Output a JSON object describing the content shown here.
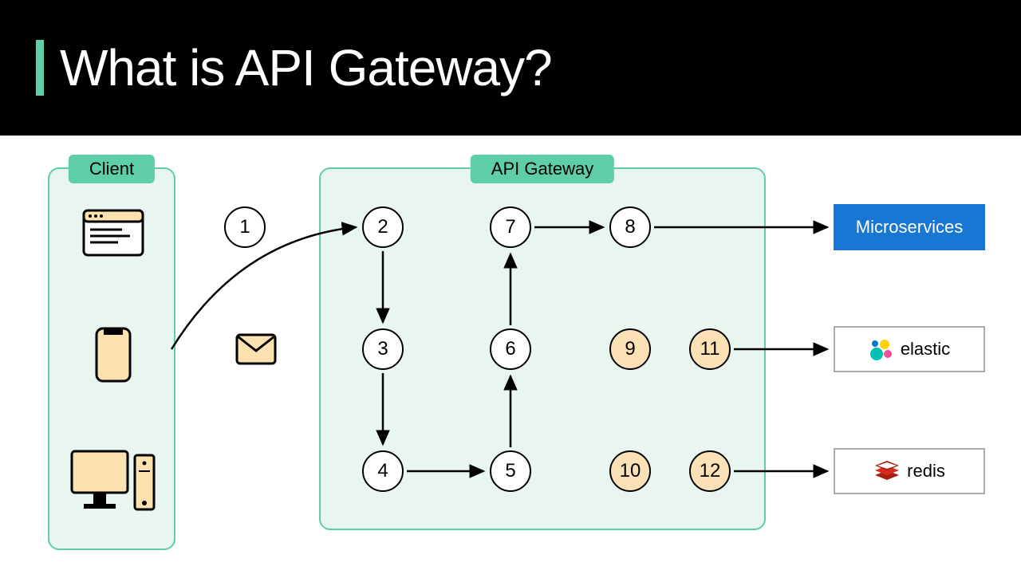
{
  "title": "What is API Gateway?",
  "panels": {
    "client": "Client",
    "gateway": "API Gateway"
  },
  "nodes": {
    "n1": "1",
    "n2": "2",
    "n3": "3",
    "n4": "4",
    "n5": "5",
    "n6": "6",
    "n7": "7",
    "n8": "8",
    "n9": "9",
    "n10": "10",
    "n11": "11",
    "n12": "12"
  },
  "services": {
    "microservices": "Microservices",
    "elastic": "elastic",
    "redis": "redis"
  },
  "clients": [
    "browser",
    "mobile",
    "desktop"
  ],
  "request_icon": "envelope",
  "arrows": [
    {
      "from": "client",
      "to": "n2",
      "curved": true
    },
    {
      "from": "n2",
      "to": "n3"
    },
    {
      "from": "n3",
      "to": "n4"
    },
    {
      "from": "n4",
      "to": "n5"
    },
    {
      "from": "n5",
      "to": "n6"
    },
    {
      "from": "n6",
      "to": "n7"
    },
    {
      "from": "n7",
      "to": "n8"
    },
    {
      "from": "n8",
      "to": "microservices"
    },
    {
      "from": "n11",
      "to": "elastic"
    },
    {
      "from": "n12",
      "to": "redis"
    }
  ],
  "shaded_nodes": [
    "n9",
    "n10",
    "n11",
    "n12"
  ]
}
